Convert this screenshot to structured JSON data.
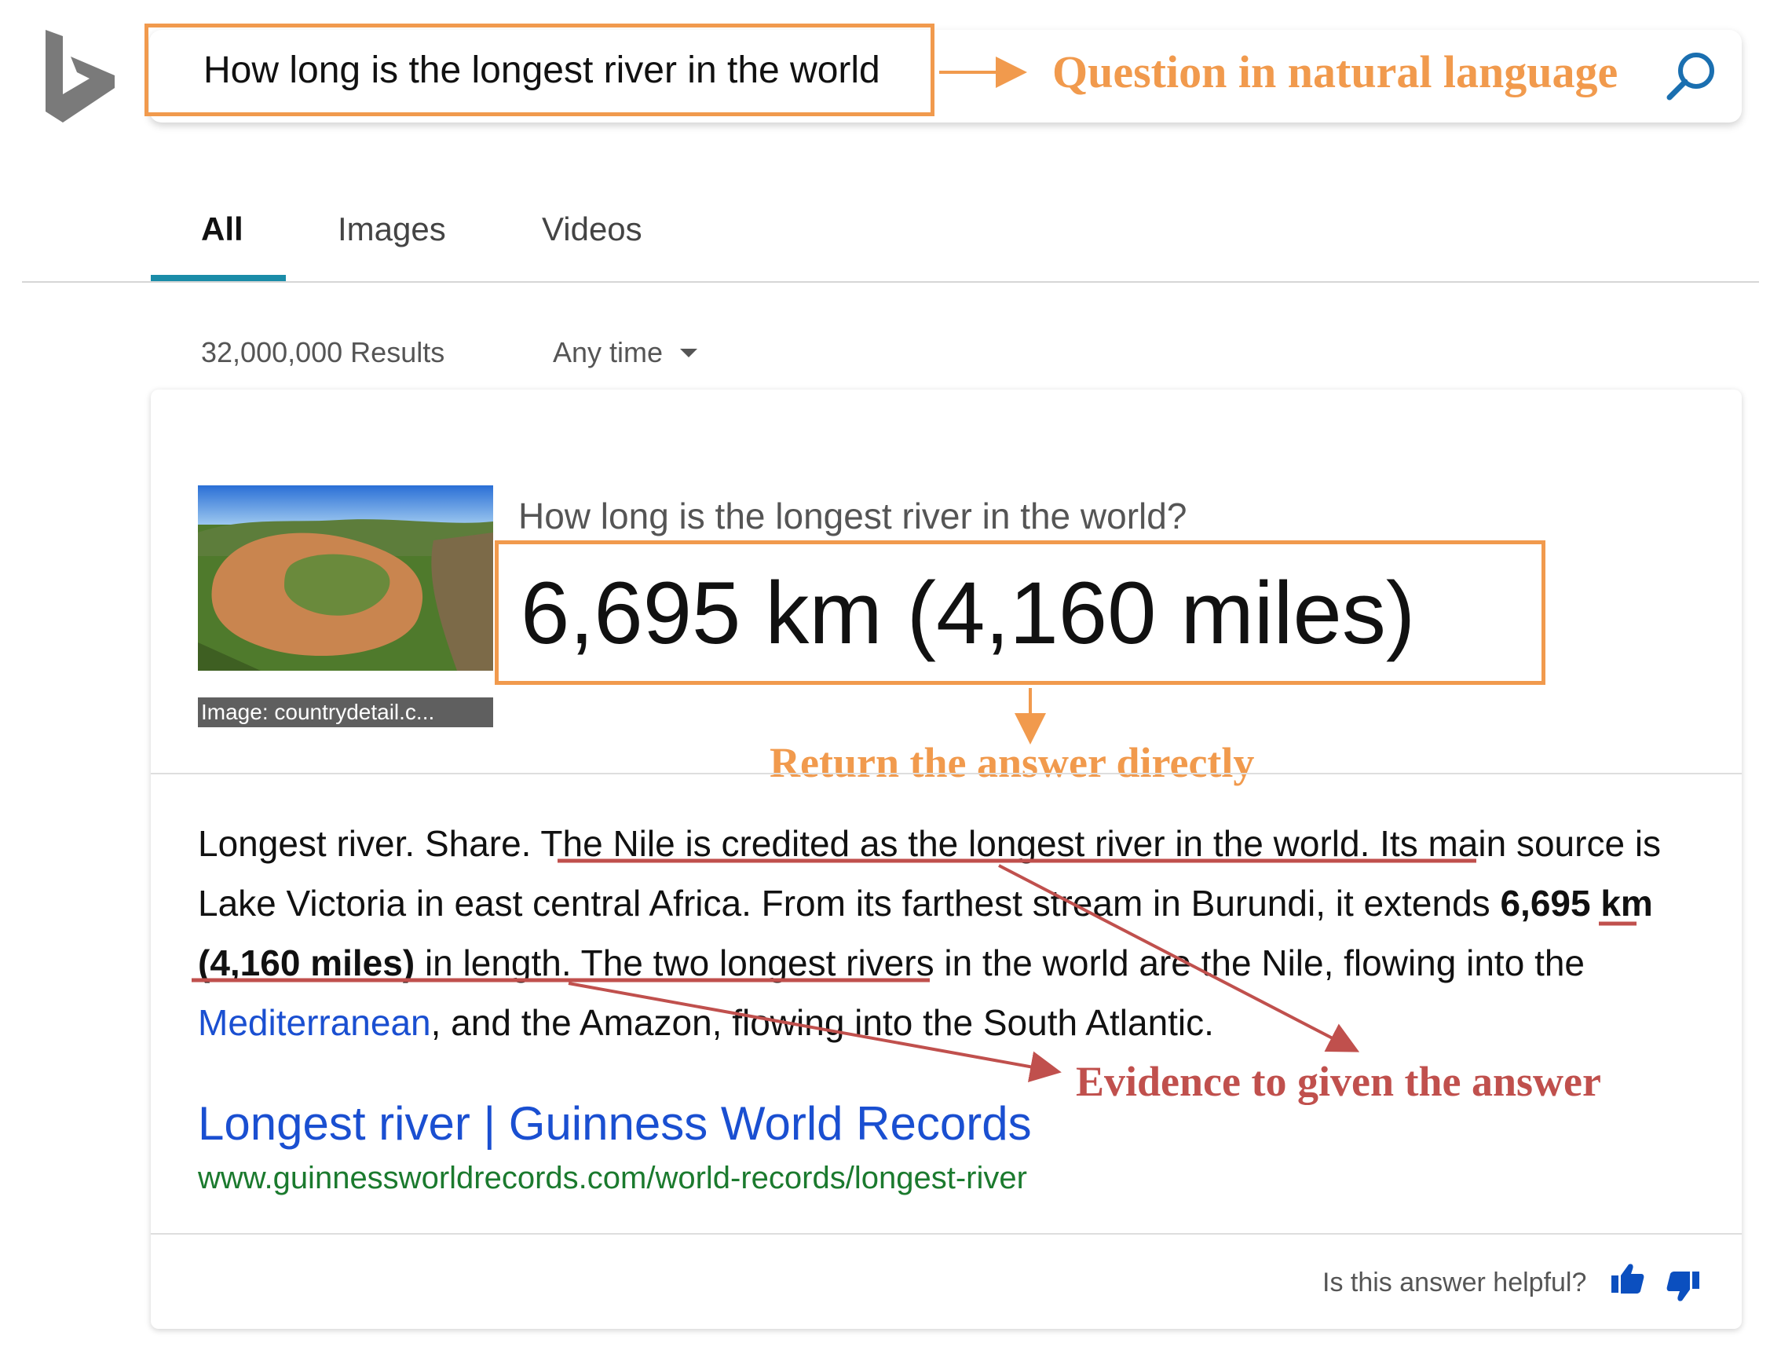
{
  "search": {
    "query": "How long is the longest river in the world"
  },
  "annotations": {
    "question_label": "Question in natural language",
    "answer_label": "Return the answer directly",
    "evidence_label": "Evidence to given the answer"
  },
  "tabs": [
    {
      "label": "All",
      "active": true
    },
    {
      "label": "Images",
      "active": false
    },
    {
      "label": "Videos",
      "active": false
    }
  ],
  "results": {
    "count": "32,000,000 Results",
    "time_filter": "Any time"
  },
  "answer_card": {
    "image_caption": "Image: countrydetail.c...",
    "question": "How long is the longest river in the world?",
    "answer": "6,695 km (4,160 miles)",
    "snippet": {
      "part1": "Longest river. Share. ",
      "part2": "The Nile is credited as the longest river in the world.",
      "part3": " Its main source is Lake Victoria in east central Africa. From its farthest stream in Burundi, ",
      "part4": "it",
      "part5": " extends ",
      "bold": "6,695 km (4,160 miles)",
      "part6": " in length.",
      "part7": " The two longest rivers in the world are the Nile, flowing into the ",
      "link": "Mediterranean",
      "part8": ", and the Amazon, flowing into the South Atlantic."
    },
    "source_title": "Longest river | Guinness World Records",
    "source_url": "www.guinnessworldrecords.com/world-records/longest-river",
    "feedback_prompt": "Is this answer helpful?"
  },
  "colors": {
    "annotation_orange": "#f19a4d",
    "annotation_red": "#c0504d",
    "link_blue": "#1a4fd1",
    "url_green": "#1b7a2e",
    "tab_accent": "#1a8ca8"
  }
}
